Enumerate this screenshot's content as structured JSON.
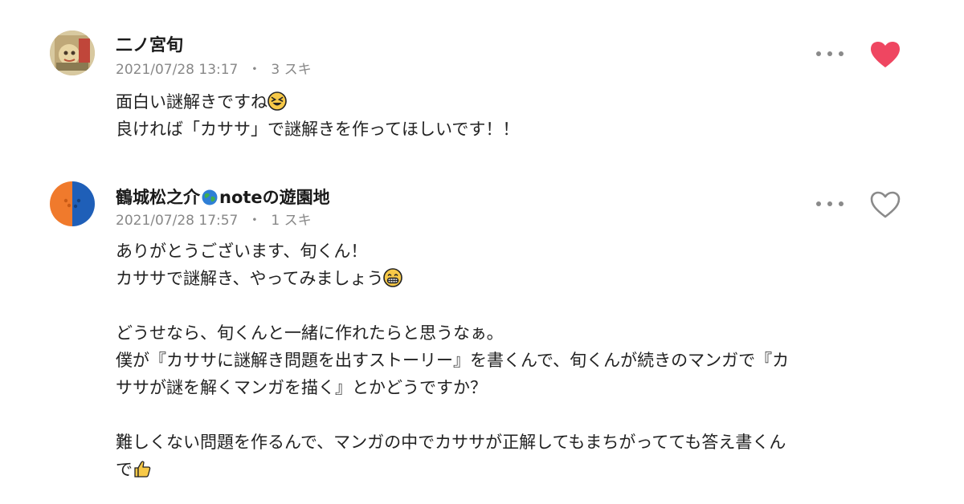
{
  "comments": [
    {
      "name": "二ノ宮旬",
      "date": "2021/07/28 13:17",
      "separator": "・",
      "likes": "3 スキ",
      "liked": true,
      "avatar_icon": "avatar-illustration-icon",
      "lines": [
        "面白い謎解きですね",
        "良ければ「カササ」で謎解きを作ってほしいです！！"
      ],
      "emojis": [
        "laughing-squint-emoji"
      ]
    },
    {
      "name_prefix": "鶴城松之介",
      "name_suffix": "noteの遊園地",
      "date": "2021/07/28 17:57",
      "separator": "・",
      "likes": "1 スキ",
      "liked": false,
      "avatar_icon": "avatar-split-orange-blue-icon",
      "lines": [
        "ありがとうございます、旬くん！",
        "カササで謎解き、やってみましょう",
        "",
        "どうせなら、旬くんと一緒に作れたらと思うなぁ。",
        "僕が『カササに謎解き問題を出すストーリー』を書くんで、旬くんが続きのマンガで『カ",
        "ササが謎を解くマンガを描く』とかどうですか？",
        "",
        "難しくない問題を作るんで、マンガの中でカササが正解してもまちがってても答え書くん",
        "で"
      ],
      "emojis": [
        "globe-emoji",
        "grinning-emoji",
        "thumbs-up-emoji"
      ]
    }
  ],
  "colors": {
    "heart_filled": "#ef4661",
    "heart_outline": "#8a8a8a",
    "meta_text": "#888888",
    "orange": "#f07a2c",
    "blue": "#1f5fb8"
  },
  "icons": {
    "more": "more-dots-icon",
    "like_filled": "heart-filled-icon",
    "like_outline": "heart-outline-icon"
  }
}
